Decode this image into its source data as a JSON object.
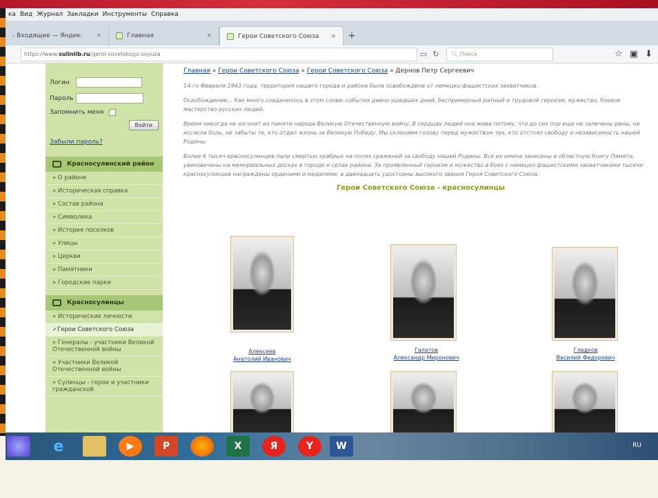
{
  "menubar": {
    "items": [
      "ка",
      "Вид",
      "Журнал",
      "Закладки",
      "Инструменты",
      "Справка"
    ]
  },
  "tabs": [
    {
      "label": "- Входящие — Яндек:"
    },
    {
      "label": "Главная"
    },
    {
      "label": "Герои Советского Союза"
    }
  ],
  "navbar": {
    "url_prefix": "https://www.",
    "url_host": "sulinlib.ru",
    "url_path": "/geroi-sovetskogo-soyuza",
    "search_placeholder": "Поиск"
  },
  "login": {
    "login_label": "Логин",
    "password_label": "Пароль",
    "remember_label": "Запомнить меня",
    "submit_label": "Войти",
    "forgot_label": "Забыли пароль?"
  },
  "sidebar": {
    "section1": "Красносулинский район",
    "items1": [
      "» О районе",
      "» Историческая справка",
      "» Состав района",
      "» Символика",
      "» История поселков",
      "» Улицы",
      "» Церкви",
      "» Памятники",
      "» Городские парки"
    ],
    "section2": "Красносулинцы",
    "items2": [
      "» Исторические личности",
      "✓Герои Советского Союза",
      "» Генералы - участники Великой Отечественной войны",
      "» Участники Великой Отечественной войны",
      "» Сулинцы - герои и участники гражданской"
    ]
  },
  "breadcrumb": [
    "Главная",
    "Герои Советского Союза",
    "Герои Советского Союза",
    "Дернов Петр Сергеевич"
  ],
  "paragraphs": [
    "14-го Февраля 1943 года, территория нашего города и района была освобождена от немецко-фашистских захватчиков.",
    "Освобождение... Как много соединилось в этом слове: события давно ушедших дней, беспримерный ратный и трудовой героизм, мужество, боевое мастерство русских людей.",
    "Время никогда не изгонит из памяти народа Великую Отечественную войну. В сердцах людей она жива потому, что до сих пор еще не залечены раны, не иссякла боль, не забыты те, кто отдал жизнь за Великую Победу. Мы склоняем голову перед мужеством тех, кто отстоял свободу и независимость нашей Родины.",
    "Более 6 тысяч красносулинцев пали смертью храбрых на полях сражений за свободу нашей Родины. Все их имена занесены в областную Книгу Памяти, увековечены на мемориальных досках в городе и селах района. За проявленный героизм и мужество в боях с немецко-фашистскими захватчиками тысячи красносулинцев награждены орденами и медалями, а двенадцать удостоены высокого звания Героя Советского Союза."
  ],
  "heroes_title": "Герои Советского Союза - красносулинцы",
  "heroes": [
    {
      "surname": "Алексеев",
      "given": "Анатолий Иванович"
    },
    {
      "surname": "Галатов",
      "given": "Александр Миронович"
    },
    {
      "surname": "Гладков",
      "given": "Василий Федорович"
    }
  ],
  "taskbar": {
    "tray": "RU"
  }
}
